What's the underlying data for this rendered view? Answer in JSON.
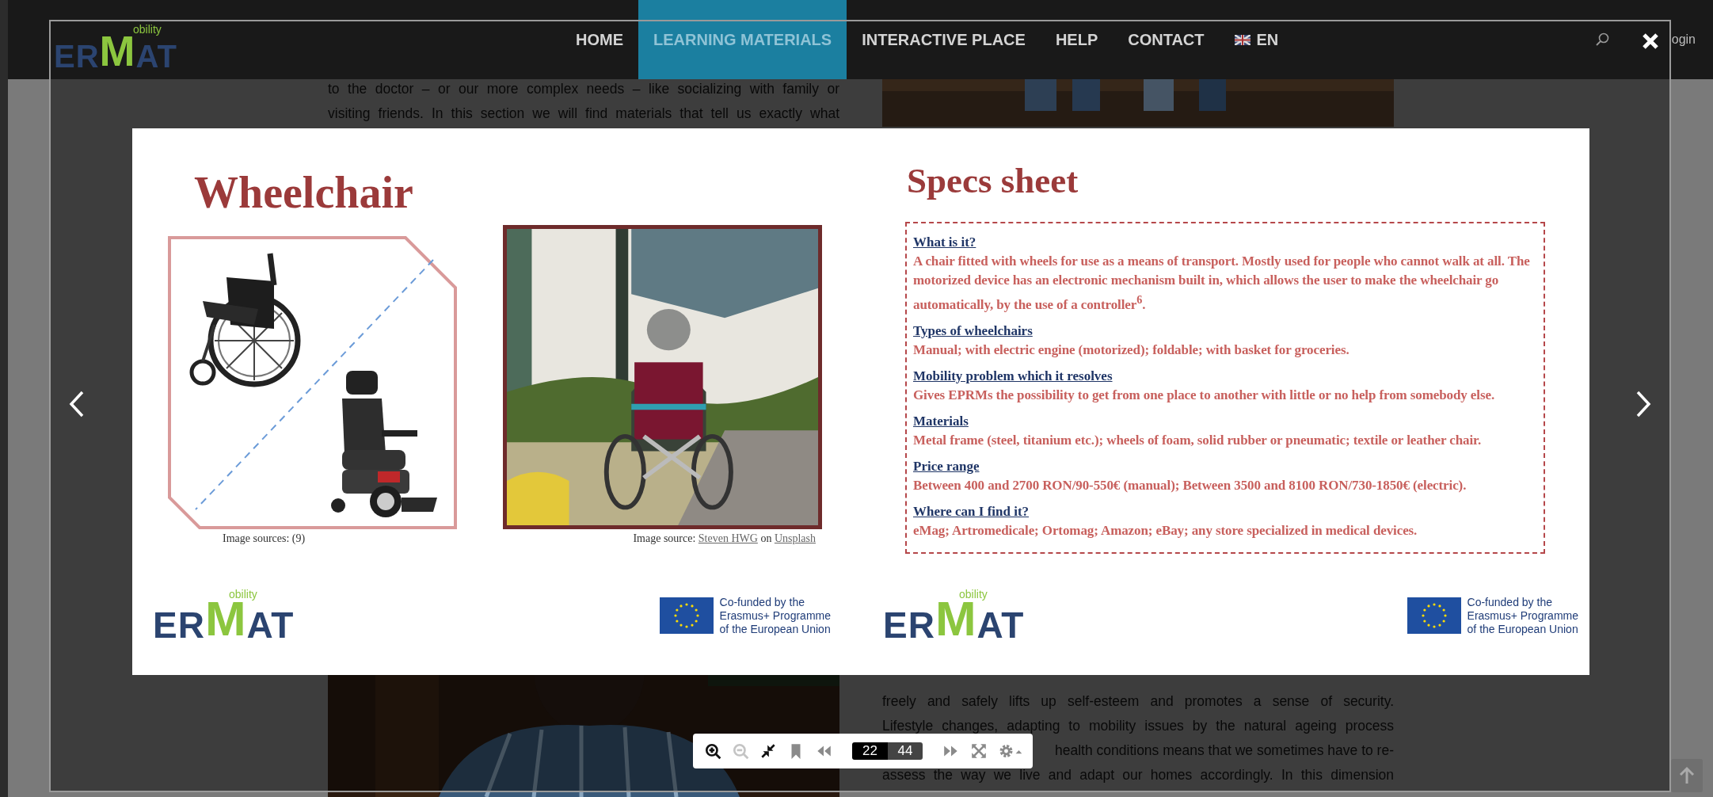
{
  "header": {
    "logo": {
      "parts": [
        "ER",
        "M",
        "AT"
      ],
      "superscript": "obility"
    },
    "nav": [
      {
        "label": "HOME",
        "selected": false,
        "kind": "link"
      },
      {
        "label": "LEARNING MATERIALS",
        "selected": true,
        "kind": "link"
      },
      {
        "label": "INTERACTIVE PLACE",
        "selected": false,
        "kind": "link"
      },
      {
        "label": "HELP",
        "selected": false,
        "kind": "link"
      },
      {
        "label": "CONTACT",
        "selected": false,
        "kind": "link"
      },
      {
        "label": "EN",
        "selected": false,
        "kind": "language"
      }
    ],
    "login": "ogin"
  },
  "background": {
    "top_lines": [
      "to the doctor – or our more complex needs – like socializing with family or",
      "visiting friends. In this section we will find materials that tell us exactly what"
    ],
    "bottom_lines": [
      "freely and safely lifts up self-esteem and promotes a sense of security.",
      "Lifestyle changes, adapting to mobility issues by the natural ageing process",
      "health conditions means that we sometimes have to re-",
      "assess the way we live and adapt our homes accordingly. In this dimension"
    ]
  },
  "lightbox": {
    "slide": {
      "left_page": {
        "title": "Wheelchair",
        "caption_left": "Image sources: (9)",
        "caption_right": [
          {
            "kind": "text",
            "text": "Image source: "
          },
          {
            "kind": "link",
            "text": "Steven HWG"
          },
          {
            "kind": "text",
            "text": " on "
          },
          {
            "kind": "link",
            "text": "Unsplash"
          }
        ],
        "logo": {
          "parts": [
            "ER",
            "M",
            "AT"
          ],
          "superscript": "obility"
        },
        "funding": "Co-funded by the\nErasmus+ Programme\nof the European Union"
      },
      "right_page": {
        "title": "Specs sheet",
        "sections": [
          {
            "heading": "What is it?",
            "body": "A chair fitted with wheels for use as a means of transport. Mostly used for people who cannot walk at all. The motorized device has an electronic mechanism built in, which allows the user to make the wheelchair go automatically, by the use of a controller$^{6}$."
          },
          {
            "heading": "Types of wheelchairs",
            "body": "Manual; with electric engine (motorized); foldable; with basket for groceries."
          },
          {
            "heading": "Mobility problem which it resolves",
            "body": "Gives EPRMs the possibility to get from one place to another with little or no help from somebody else."
          },
          {
            "heading": "Materials",
            "body": "Metal frame (steel, titanium etc.); wheels of foam, solid rubber or pneumatic; textile or leather chair."
          },
          {
            "heading": "Price range",
            "body": "Between 400 and 2700 RON/90-550€ (manual); Between 3500 and 8100 RON/730-1850€ (electric)."
          },
          {
            "heading": "Where can I find it?",
            "body": "eMag; Artromedicale; Ortomag; Amazon; eBay; any store specialized in medical devices."
          }
        ],
        "logo": {
          "parts": [
            "ER",
            "M",
            "AT"
          ],
          "superscript": "obility"
        },
        "funding": "Co-funded by the\nErasmus+ Programme\nof the European Union"
      }
    },
    "toolbar": {
      "buttons_before": [
        {
          "kind": "zoom-in",
          "disabled": false
        },
        {
          "kind": "zoom-out",
          "disabled": true
        },
        {
          "kind": "collapse",
          "disabled": false
        },
        {
          "kind": "bookmark",
          "disabled": false
        },
        {
          "kind": "previous",
          "disabled": false
        }
      ],
      "current_page": "22",
      "total_pages": "44",
      "buttons_after": [
        {
          "kind": "next",
          "disabled": false
        },
        {
          "kind": "fullscreen",
          "disabled": false
        },
        {
          "kind": "settings",
          "disabled": false
        }
      ]
    }
  }
}
